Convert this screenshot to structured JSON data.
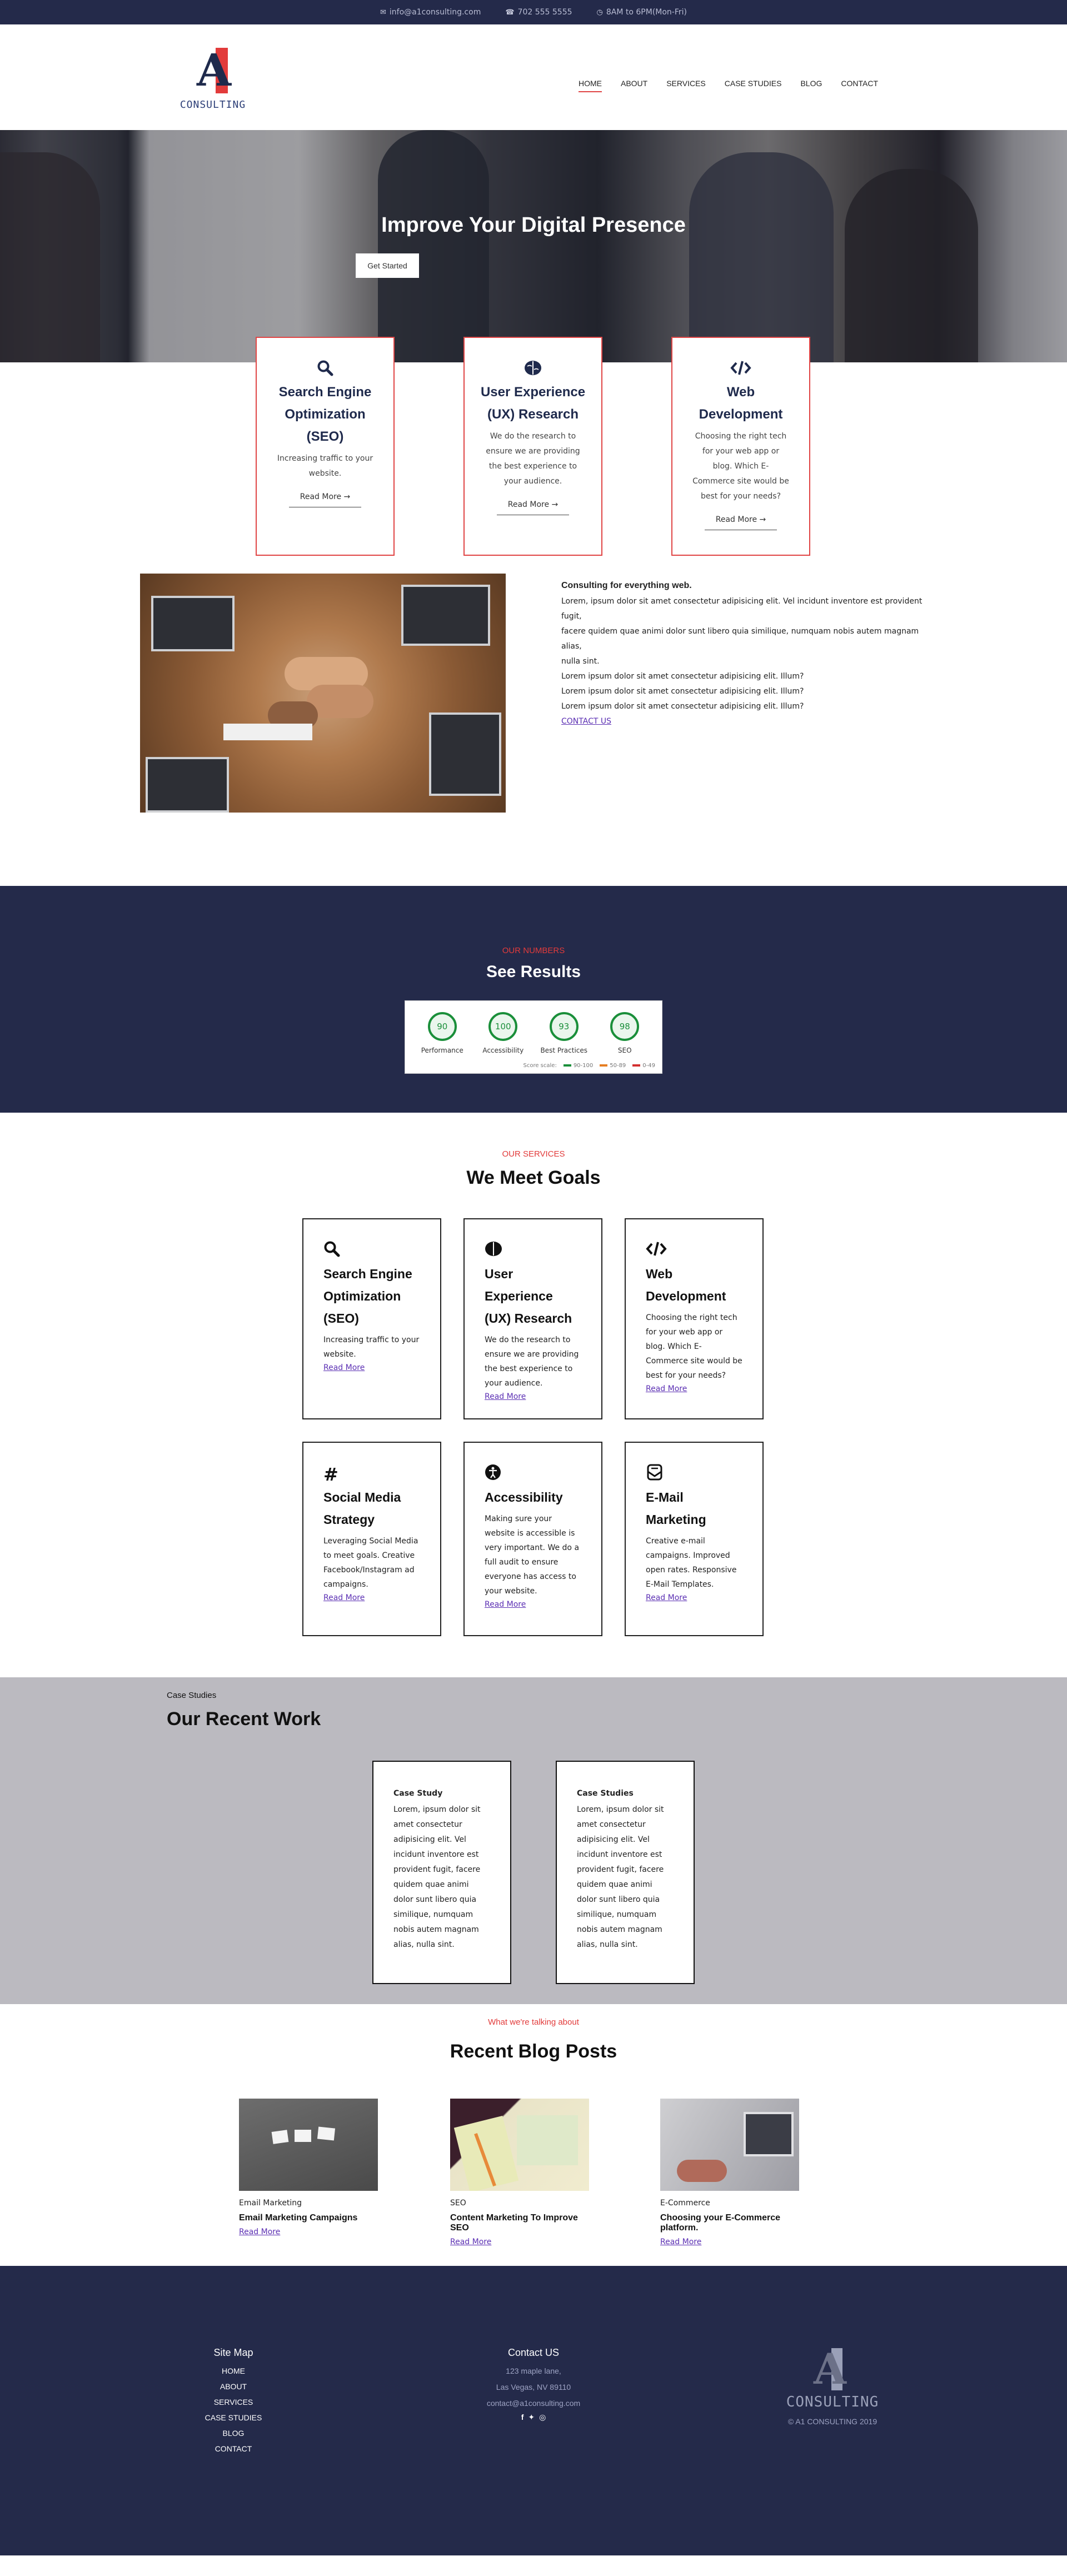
{
  "topbar": {
    "email": "info@a1consulting.com",
    "phone": "702 555 5555",
    "hours": "8AM to 6PM(Mon-Fri)",
    "email_icon": "envelope-icon",
    "phone_icon": "phone-icon",
    "hours_icon": "clock-icon"
  },
  "logo": {
    "mark": "A",
    "word": "CONSULTING"
  },
  "nav": {
    "items": [
      {
        "label": "HOME"
      },
      {
        "label": "ABOUT"
      },
      {
        "label": "SERVICES"
      },
      {
        "label": "CASE STUDIES"
      },
      {
        "label": "BLOG"
      },
      {
        "label": "CONTACT"
      }
    ],
    "active": "HOME",
    "accent": "#e04545"
  },
  "hero": {
    "title": "Improve Your Digital Presence",
    "button": "Get Started"
  },
  "features": [
    {
      "icon": "search-icon",
      "title_lines": [
        "Search Engine",
        "Optimization",
        "(SEO)"
      ],
      "text_lines": [
        "Increasing traffic to your",
        "website."
      ],
      "link": "Read More →"
    },
    {
      "icon": "brain-icon",
      "title_lines": [
        "User Experience",
        "(UX) Research"
      ],
      "text_lines": [
        "We do the research to",
        "ensure we are providing",
        "the best experience to",
        "your audience."
      ],
      "link": "Read More →"
    },
    {
      "icon": "code-icon",
      "title_lines": [
        "Web",
        "Development"
      ],
      "text_lines": [
        "Choosing the right tech",
        "for your web app or",
        "blog. Which E-",
        "Commerce site would be",
        "best for your needs?"
      ],
      "link": "Read More →"
    }
  ],
  "consulting": {
    "heading": "Consulting for everything web.",
    "lines": [
      "Lorem, ipsum dolor sit amet consectetur adipisicing elit. Vel incidunt inventore est provident fugit,",
      "facere quidem quae animi dolor sunt libero quia similique, numquam nobis autem magnam alias,",
      "nulla sint.",
      "Lorem ipsum dolor sit amet consectetur adipisicing elit. Illum?",
      "Lorem ipsum dolor sit amet consectetur adipisicing elit. Illum?",
      "Lorem ipsum dolor sit amet consectetur adipisicing elit. Illum?"
    ],
    "link": "CONTACT US"
  },
  "numbers": {
    "eyebrow": "OUR NUMBERS",
    "title": "See Results",
    "gauges": [
      {
        "value": "90",
        "label": "Performance"
      },
      {
        "value": "100",
        "label": "Accessibility"
      },
      {
        "value": "93",
        "label": "Best Practices"
      },
      {
        "value": "98",
        "label": "SEO"
      }
    ],
    "legend": {
      "title": "Score scale:",
      "good": "90-100",
      "mid": "50-89",
      "bad": "0-49"
    },
    "colors": {
      "good": "#1a8f3a",
      "mid": "#e67e22",
      "bad": "#d32f2f"
    }
  },
  "services": {
    "eyebrow": "OUR SERVICES",
    "title": "We Meet Goals",
    "cards": [
      {
        "icon": "search-icon",
        "title_lines": [
          "Search Engine",
          "Optimization",
          "(SEO)"
        ],
        "text_lines": [
          "Increasing traffic to your",
          "website."
        ],
        "link": "Read More"
      },
      {
        "icon": "brain-icon",
        "title_lines": [
          "User Experience",
          "(UX) Research"
        ],
        "text_lines": [
          "We do the research to",
          "ensure we are providing",
          "the best experience to",
          "your audience."
        ],
        "link": "Read More"
      },
      {
        "icon": "code-icon",
        "title_lines": [
          "Web",
          "Development"
        ],
        "text_lines": [
          "Choosing the right tech",
          "for your web app or",
          "blog. Which E-",
          "Commerce site would be",
          "best for your needs?"
        ],
        "link": "Read More"
      },
      {
        "icon": "hashtag-icon",
        "title_lines": [
          "Social Media",
          "Strategy"
        ],
        "text_lines": [
          "Leveraging Social Media",
          "to meet goals. Creative",
          "Facebook/Instagram ad",
          "campaigns."
        ],
        "link": "Read More"
      },
      {
        "icon": "accessibility-icon",
        "title_lines": [
          "Accessibility"
        ],
        "text_lines": [
          "Making sure your",
          "website is accessible is",
          "very important. We do a",
          "full audit to ensure",
          "everyone has access to",
          "your website."
        ],
        "link": "Read More"
      },
      {
        "icon": "mail-bulk-icon",
        "title_lines": [
          "E-Mail",
          "Marketing"
        ],
        "text_lines": [
          "Creative e-mail",
          "campaigns. Improved",
          "open rates. Responsive",
          "E-Mail Templates."
        ],
        "link": "Read More"
      }
    ]
  },
  "cases": {
    "eyebrow": "Case Studies",
    "title": "Our Recent Work",
    "cards": [
      {
        "title": "Case Study",
        "lines": [
          "Lorem, ipsum dolor sit",
          "amet consectetur",
          "adipisicing elit. Vel",
          "incidunt inventore est",
          "provident fugit, facere",
          "quidem quae animi",
          "dolor sunt libero quia",
          "similique, numquam",
          "nobis autem magnam",
          "alias, nulla sint."
        ]
      },
      {
        "title": "Case Studies",
        "lines": [
          "Lorem, ipsum dolor sit",
          "amet consectetur",
          "adipisicing elit. Vel",
          "incidunt inventore est",
          "provident fugit, facere",
          "quidem quae animi",
          "dolor sunt libero quia",
          "similique, numquam",
          "nobis autem magnam",
          "alias, nulla sint."
        ]
      }
    ]
  },
  "blog": {
    "eyebrow": "What we're talking about",
    "title": "Recent Blog Posts",
    "posts": [
      {
        "category": "Email Marketing",
        "title": "Email Marketing Campaigns",
        "link": "Read More"
      },
      {
        "category": "SEO",
        "title": "Content Marketing To Improve SEO",
        "link": "Read More"
      },
      {
        "category": "E-Commerce",
        "title": "Choosing your E-Commerce platform.",
        "link": "Read More"
      }
    ]
  },
  "footer": {
    "sitemap_title": "Site Map",
    "sitemap": [
      "HOME",
      "ABOUT",
      "SERVICES",
      "CASE STUDIES",
      "BLOG",
      "CONTACT"
    ],
    "contact_title": "Contact US",
    "address1": "123 maple lane,",
    "address2": "Las Vegas, NV 89110",
    "email": "contact@a1consulting.com",
    "social_icons": [
      "facebook-icon",
      "twitter-icon",
      "instagram-icon"
    ],
    "logo_word": "CONSULTING",
    "copyright": "© A1 CONSULTING 2019"
  }
}
